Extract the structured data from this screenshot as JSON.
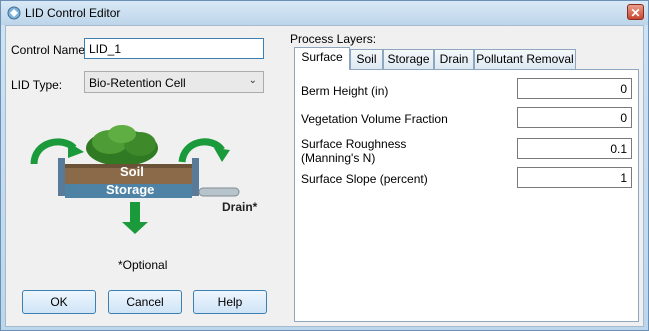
{
  "window": {
    "title": "LID Control Editor",
    "close_glyph": "✕"
  },
  "form": {
    "control_name_label": "Control Name:",
    "control_name_value": "LID_1",
    "lid_type_label": "LID Type:",
    "lid_type_value": "Bio-Retention Cell"
  },
  "diagram": {
    "soil_label": "Soil",
    "storage_label": "Storage",
    "drain_label": "Drain*",
    "optional_label": "*Optional"
  },
  "buttons": {
    "ok": "OK",
    "cancel": "Cancel",
    "help": "Help"
  },
  "process_layers": {
    "heading": "Process Layers:",
    "tabs": [
      "Surface",
      "Soil",
      "Storage",
      "Drain",
      "Pollutant Removal"
    ],
    "active_tab": "Surface"
  },
  "surface": {
    "berm_height_label": "Berm Height (in)",
    "berm_height_value": "0",
    "vegetation_label": "Vegetation Volume Fraction",
    "vegetation_value": "0",
    "roughness_label_line1": "Surface Roughness",
    "roughness_label_line2": "(Manning's N)",
    "roughness_value": "0.1",
    "slope_label": "Surface Slope (percent)",
    "slope_value": "1"
  }
}
